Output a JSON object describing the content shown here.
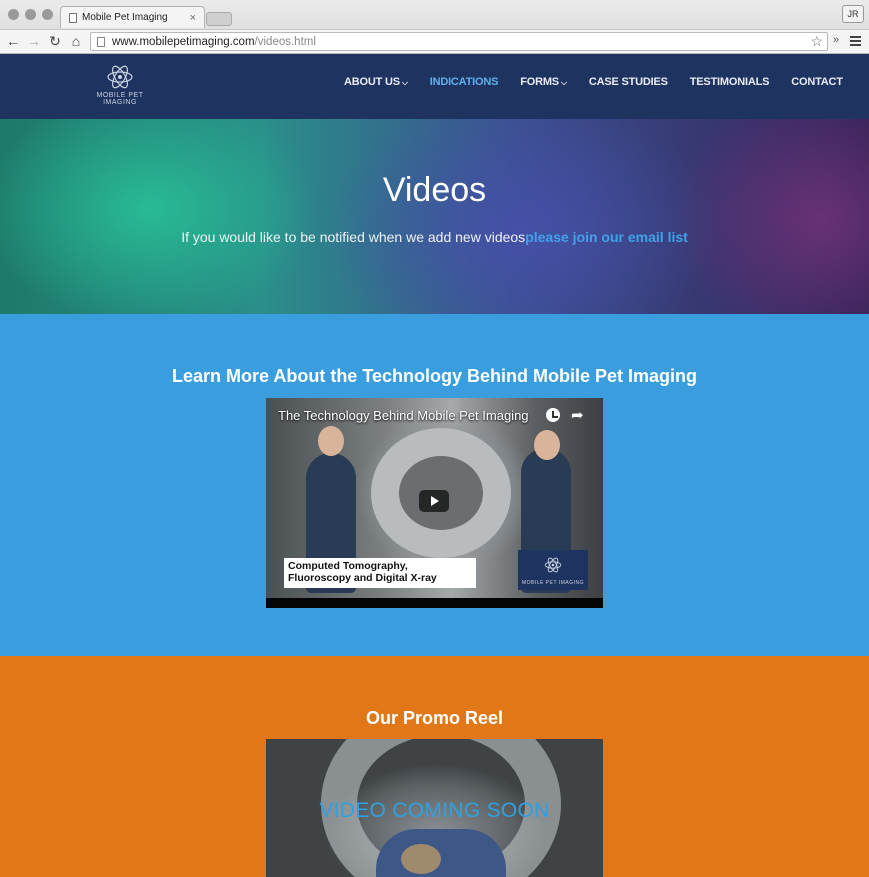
{
  "browser": {
    "tab_title": "Mobile Pet Imaging",
    "tab_close": "×",
    "profile_initials": "JR",
    "url_host": "www.mobilepetimaging.com",
    "url_path": "/videos.html",
    "back_icon": "←",
    "forward_icon": "→",
    "reload_icon": "↻",
    "home_icon": "⌂",
    "star_icon": "☆",
    "extensions_icon": "»"
  },
  "header": {
    "logo_text": "MOBILE PET IMAGING",
    "nav": [
      {
        "label": "ABOUT US",
        "caret": "⌵"
      },
      {
        "label": "INDICATIONS"
      },
      {
        "label": "FORMS",
        "caret": "⌵"
      },
      {
        "label": "CASE STUDIES"
      },
      {
        "label": "TESTIMONIALS"
      },
      {
        "label": "CONTACT"
      }
    ],
    "active_color": "#5fb2ee",
    "background": "#1e3360"
  },
  "hero": {
    "title": "Videos",
    "subtitle_text": "If you would like to be notified when we add new videos",
    "subtitle_link": "please join our email list"
  },
  "technology_section": {
    "title": "Learn More About the Technology Behind Mobile Pet Imaging",
    "video_title": "The Technology Behind Mobile Pet Imaging",
    "caption": "Computed Tomography, Fluoroscopy and Digital X-ray",
    "badge_text": "MOBILE PET IMAGING",
    "share_icon": "➦",
    "background": "#3a9ddd"
  },
  "promo_section": {
    "title": "Our Promo Reel",
    "coming_soon": "VIDEO COMING SOON",
    "background": "#e27717"
  }
}
